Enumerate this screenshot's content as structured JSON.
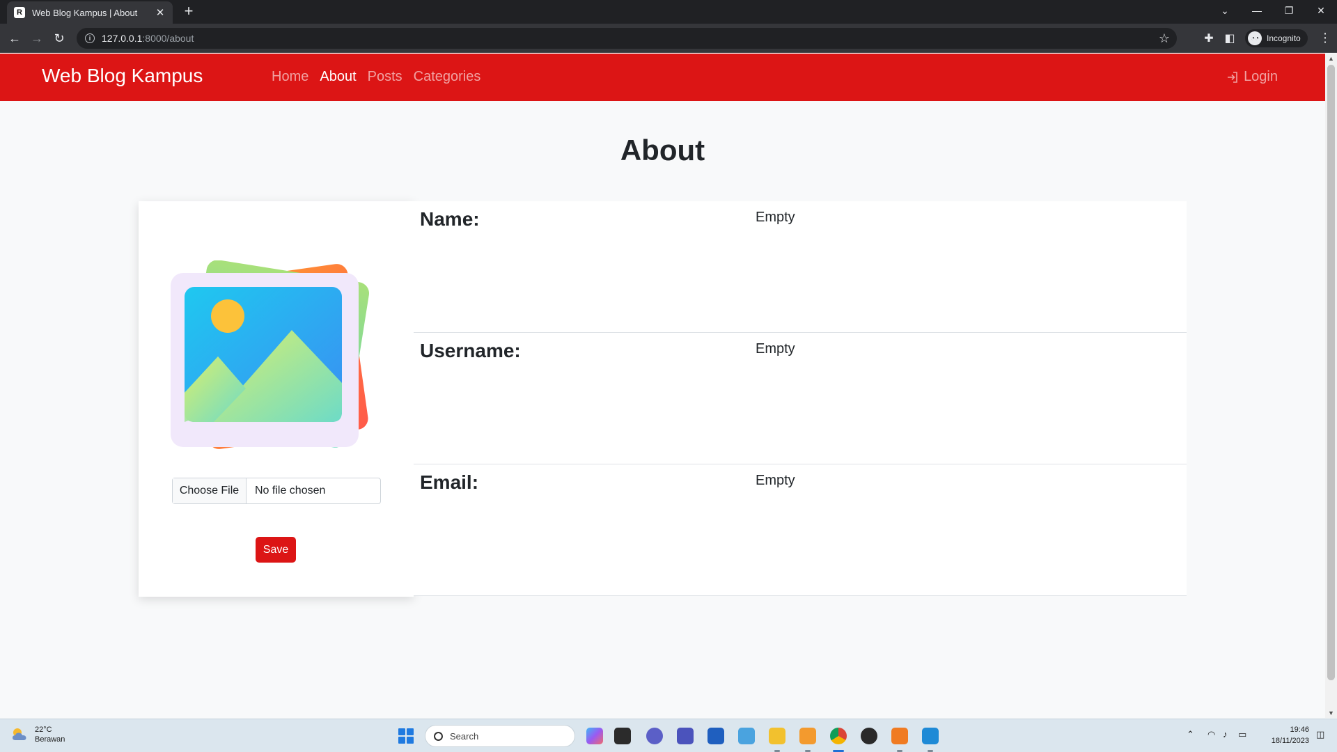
{
  "browser": {
    "tab_title": "Web Blog Kampus | About",
    "tab_favicon": "R",
    "url_host": "127.0.0.1",
    "url_path": ":8000/about",
    "profile_label": "Incognito"
  },
  "navbar": {
    "brand": "Web Blog Kampus",
    "links": [
      {
        "label": "Home",
        "active": false
      },
      {
        "label": "About",
        "active": true
      },
      {
        "label": "Posts",
        "active": false
      },
      {
        "label": "Categories",
        "active": false
      }
    ],
    "login_label": "Login"
  },
  "page": {
    "title": "About",
    "upload": {
      "button_label": "Choose File",
      "status_text": "No file chosen"
    },
    "save_label": "Save",
    "fields": [
      {
        "label": "Name:",
        "value": "Empty"
      },
      {
        "label": "Username:",
        "value": "Empty"
      },
      {
        "label": "Email:",
        "value": "Empty"
      }
    ]
  },
  "taskbar": {
    "weather_temp": "22°C",
    "weather_desc": "Berawan",
    "search_placeholder": "Search",
    "time": "19:46",
    "date": "18/11/2023"
  },
  "colors": {
    "navbar": "#dc1515",
    "save_button": "#dc1515",
    "page_background": "#f8f9fa"
  }
}
